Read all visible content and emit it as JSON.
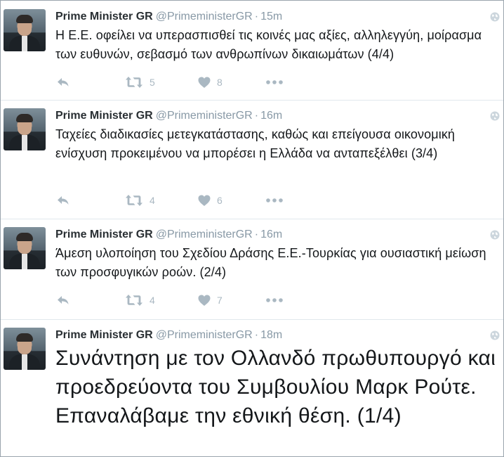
{
  "tweets": [
    {
      "name": "Prime Minister GR",
      "handle": "@PrimeministerGR",
      "separator": "·",
      "time": "15m",
      "text": "Η Ε.Ε. οφείλει να υπερασπισθεί τις κοινές μας αξίες, αλληλεγγύη, μοίρασμα των ευθυνών, σεβασμό των ανθρωπίνων δικαιωμάτων (4/4)",
      "retweets": "5",
      "likes": "8"
    },
    {
      "name": "Prime Minister GR",
      "handle": "@PrimeministerGR",
      "separator": "·",
      "time": "16m",
      "text": "Ταχείες διαδικασίες μετεγκατάστασης,  καθώς και επείγουσα οικονομική ενίσχυση προκειμένου να μπορέσει η Ελλάδα να ανταπεξέλθει (3/4)",
      "retweets": "4",
      "likes": "6"
    },
    {
      "name": "Prime Minister GR",
      "handle": "@PrimeministerGR",
      "separator": "·",
      "time": "16m",
      "text": "Άμεση υλοποίηση του Σχεδίου Δράσης Ε.Ε.-Τουρκίας για ουσιαστική μείωση των προσφυγικών ροών. (2/4)",
      "retweets": "4",
      "likes": "7"
    },
    {
      "name": "Prime Minister GR",
      "handle": "@PrimeministerGR",
      "separator": "·",
      "time": "18m",
      "text": "Συνάντηση με τον Ολλανδό πρωθυπουργό και προεδρεύοντα του Συμβουλίου Μαρκ Ρούτε. Επαναλάβαμε την εθνική θέση. (1/4)"
    }
  ],
  "icons": {
    "reply": "reply-icon",
    "retweet": "retweet-icon",
    "like": "heart-icon",
    "more": "more-icon",
    "globe": "globe-icon"
  },
  "colors": {
    "icon": "#aab8c2",
    "handle": "#8899a6",
    "divider": "#e1e8ed"
  }
}
